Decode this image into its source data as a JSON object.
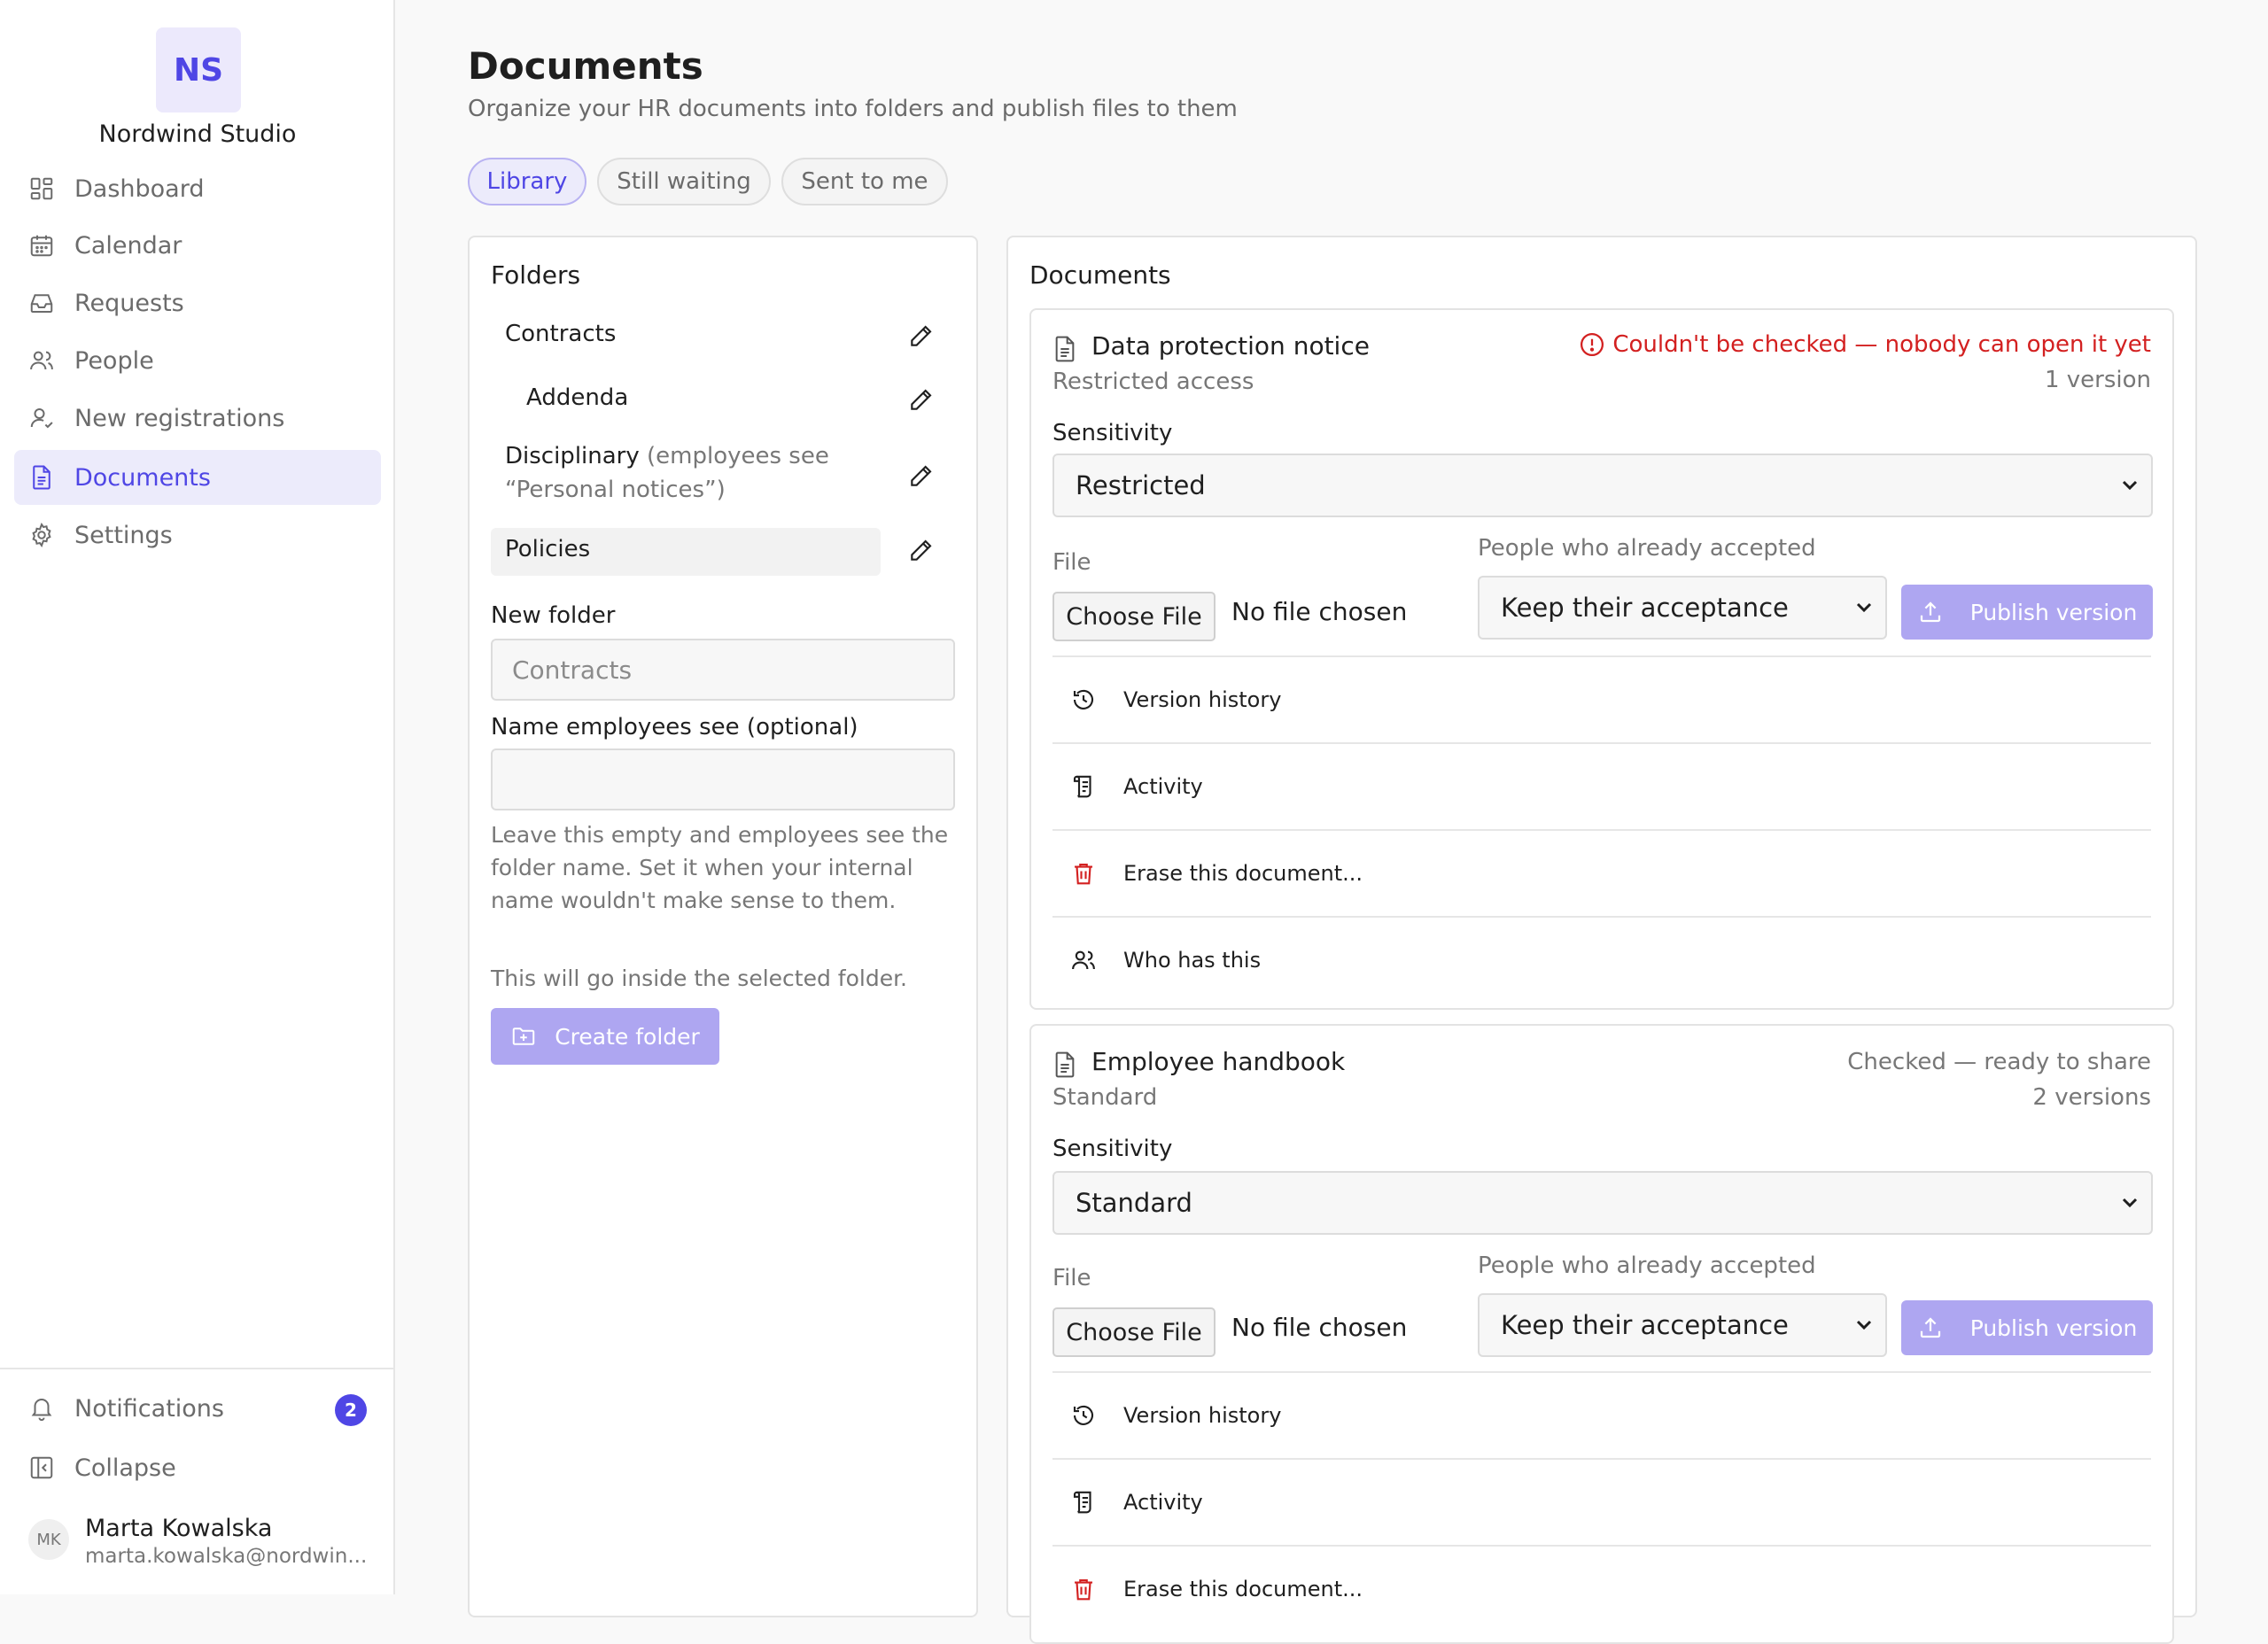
{
  "sidebar": {
    "logo_initials": "NS",
    "org_name": "Nordwind Studio",
    "items": [
      {
        "label": "Dashboard",
        "icon": "dashboard-icon"
      },
      {
        "label": "Calendar",
        "icon": "calendar-icon"
      },
      {
        "label": "Requests",
        "icon": "inbox-icon"
      },
      {
        "label": "People",
        "icon": "users-icon"
      },
      {
        "label": "New registrations",
        "icon": "user-check-icon"
      },
      {
        "label": "Documents",
        "icon": "document-icon",
        "active": true
      },
      {
        "label": "Settings",
        "icon": "gear-icon"
      }
    ],
    "notifications_label": "Notifications",
    "notifications_count": "2",
    "collapse_label": "Collapse",
    "user": {
      "initials": "MK",
      "name": "Marta Kowalska",
      "email": "marta.kowalska@nordwin..."
    }
  },
  "header": {
    "title": "Documents",
    "subtitle": "Organize your HR documents into folders and publish files to them"
  },
  "tabs": [
    {
      "label": "Library",
      "active": true
    },
    {
      "label": "Still waiting"
    },
    {
      "label": "Sent to me"
    }
  ],
  "folders": {
    "title": "Folders",
    "items": [
      {
        "name": "Contracts",
        "hint": ""
      },
      {
        "name": "Addenda",
        "hint": ""
      },
      {
        "name": "Disciplinary",
        "hint": "(employees see",
        "hint2": "“Personal notices”)"
      },
      {
        "name": "Policies",
        "hint": "",
        "selected": true
      }
    ],
    "new_folder_label": "New folder",
    "new_folder_placeholder": "Contracts",
    "employee_name_label": "Name employees see (optional)",
    "employee_name_value": "",
    "help_text": "Leave this empty and employees see the folder name. Set it when your internal name wouldn't make sense to them.",
    "inside_text": "This will go inside the selected folder.",
    "create_label": "Create folder"
  },
  "documents": {
    "title": "Documents",
    "items": [
      {
        "name": "Data protection notice",
        "access": "Restricted access",
        "status": "Couldn't be checked — nobody can open it yet",
        "status_type": "error",
        "versions": "1 version",
        "sensitivity_label": "Sensitivity",
        "sensitivity": "Restricted",
        "file_label": "File",
        "choose_label": "Choose File",
        "no_file": "No file chosen",
        "accepted_label": "People who already accepted",
        "accepted_value": "Keep their acceptance",
        "publish_label": "Publish version",
        "actions": [
          "Version history",
          "Activity",
          "Erase this document...",
          "Who has this"
        ]
      },
      {
        "name": "Employee handbook",
        "access": "Standard",
        "status": "Checked — ready to share",
        "status_type": "ok",
        "versions": "2 versions",
        "sensitivity_label": "Sensitivity",
        "sensitivity": "Standard",
        "file_label": "File",
        "choose_label": "Choose File",
        "no_file": "No file chosen",
        "accepted_label": "People who already accepted",
        "accepted_value": "Keep their acceptance",
        "publish_label": "Publish version",
        "actions": [
          "Version history",
          "Activity",
          "Erase this document..."
        ]
      }
    ]
  },
  "colors": {
    "accent": "#4f46e5",
    "accent_soft": "#ecebfb",
    "button_disabled": "#aea6f1",
    "error": "#d32020"
  }
}
